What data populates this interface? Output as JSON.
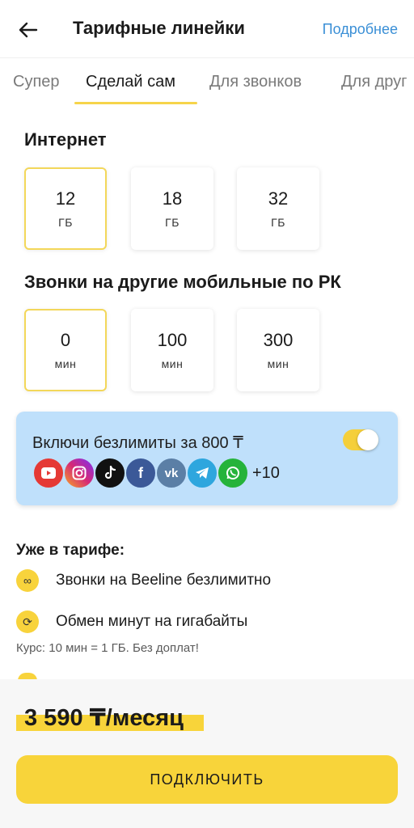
{
  "header": {
    "title": "Тарифные линейки",
    "more": "Подробнее"
  },
  "tabs": [
    {
      "label": "Супер"
    },
    {
      "label": "Сделай сам",
      "active": true
    },
    {
      "label": "Для звонков"
    },
    {
      "label": "Для друг"
    }
  ],
  "internet": {
    "title": "Интернет",
    "options": [
      {
        "value": "12",
        "unit": "ГБ",
        "selected": true
      },
      {
        "value": "18",
        "unit": "ГБ"
      },
      {
        "value": "32",
        "unit": "ГБ"
      }
    ]
  },
  "calls": {
    "title": "Звонки на другие мобильные по РК",
    "options": [
      {
        "value": "0",
        "unit": "мин",
        "selected": true
      },
      {
        "value": "100",
        "unit": "мин"
      },
      {
        "value": "300",
        "unit": "мин"
      }
    ]
  },
  "unlimited": {
    "title": "Включи безлимиты за 800 ₸",
    "toggle_on": true,
    "apps": [
      {
        "name": "youtube-icon",
        "color": "#e53935"
      },
      {
        "name": "instagram-icon",
        "color": "#d62976"
      },
      {
        "name": "tiktok-icon",
        "color": "#111111"
      },
      {
        "name": "facebook-icon",
        "color": "#3b5998"
      },
      {
        "name": "vk-icon",
        "color": "#5b7fa6"
      },
      {
        "name": "telegram-icon",
        "color": "#2ea6de"
      },
      {
        "name": "whatsapp-icon",
        "color": "#25b33a"
      }
    ],
    "more_count": "+10"
  },
  "included": {
    "title": "Уже в тарифе:",
    "items": [
      {
        "label": "Звонки на Beeline безлимитно",
        "icon": "infinity-icon"
      },
      {
        "label": "Обмен минут на гигабайты",
        "icon": "exchange-icon"
      }
    ],
    "rate": "Курс: 10 мин = 1 ГБ. Без доплат!"
  },
  "footer": {
    "price": "3 590 ₸/месяц",
    "cta": "ПОДКЛЮЧИТЬ"
  },
  "colors": {
    "accent": "#f8d43a",
    "link": "#3a8fd6",
    "promo_bg": "#bfe0fb"
  }
}
